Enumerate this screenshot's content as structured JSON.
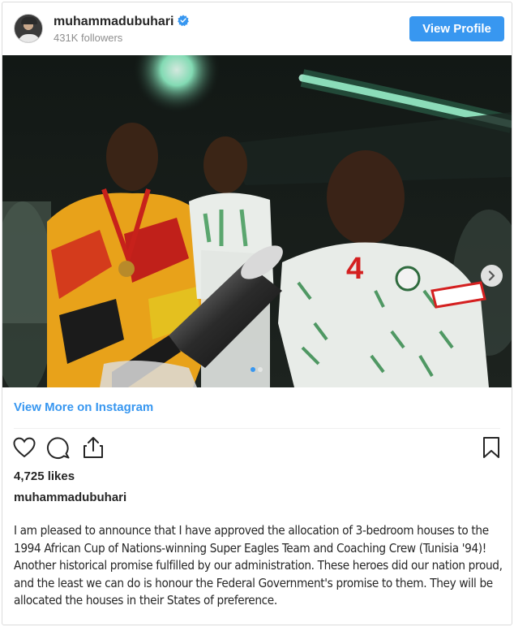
{
  "post": {
    "username": "muhammadubuhari",
    "followers": "431K followers",
    "view_profile_label": "View Profile",
    "view_more_label": "View More on Instagram",
    "likes": "4,725 likes",
    "caption_author": "muhammadubuhari",
    "caption": "I am pleased to announce that I have approved the allocation of 3-bedroom houses to the 1994 African Cup of Nations-winning Super Eagles Team and Coaching Crew (Tunisia '94)! Another historical promise fulfilled by our administration. These heroes did our nation proud, and the least we can do is honour the Federal Government's promise to them. They will be allocated the houses in their States of preference.",
    "jersey_number": "4"
  },
  "icons": {
    "verified": "verified-badge-icon",
    "like": "heart-icon",
    "comment": "comment-icon",
    "share": "share-icon",
    "save": "bookmark-icon",
    "next": "chevron-right-icon"
  },
  "colors": {
    "accent": "#3897f0",
    "text": "#262626",
    "muted": "#8e8e8e",
    "border": "#dbdbdb"
  }
}
